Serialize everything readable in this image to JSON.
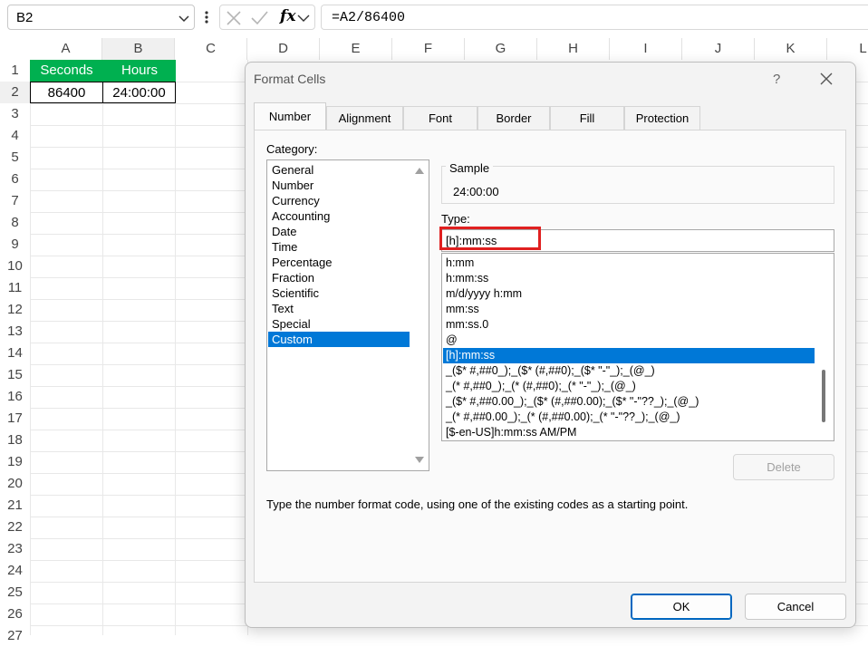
{
  "formula_bar": {
    "name_box": "B2",
    "formula": "=A2/86400",
    "fx_label": "fx"
  },
  "sheet": {
    "columns": [
      "A",
      "B",
      "C",
      "D",
      "E",
      "F",
      "G",
      "H",
      "I",
      "J",
      "K",
      "L"
    ],
    "rows": [
      "1",
      "2",
      "3",
      "4",
      "5",
      "6",
      "7",
      "8",
      "9",
      "10",
      "11",
      "12",
      "13",
      "14",
      "15",
      "16",
      "17",
      "18",
      "19",
      "20",
      "21",
      "22",
      "23",
      "24",
      "25",
      "26",
      "27"
    ],
    "cells": {
      "a1": "Seconds",
      "b1": "Hours",
      "a2": "86400",
      "b2": "24:00:00"
    },
    "header_fill": "#00b050"
  },
  "dialog": {
    "title": "Format Cells",
    "help": "?",
    "tabs": [
      "Number",
      "Alignment",
      "Font",
      "Border",
      "Fill",
      "Protection"
    ],
    "active_tab": "Number",
    "category_label": "Category:",
    "categories": [
      "General",
      "Number",
      "Currency",
      "Accounting",
      "Date",
      "Time",
      "Percentage",
      "Fraction",
      "Scientific",
      "Text",
      "Special",
      "Custom"
    ],
    "selected_category": "Custom",
    "sample_label": "Sample",
    "sample_value": "24:00:00",
    "type_label": "Type:",
    "type_value": "[h]:mm:ss",
    "type_list": [
      "h:mm",
      "h:mm:ss",
      "m/d/yyyy h:mm",
      "mm:ss",
      "mm:ss.0",
      "@",
      "[h]:mm:ss",
      "_($* #,##0_);_($* (#,##0);_($* \"-\"_);_(@_)",
      "_(* #,##0_);_(* (#,##0);_(* \"-\"_);_(@_)",
      "_($* #,##0.00_);_($* (#,##0.00);_($* \"-\"??_);_(@_)",
      "_(* #,##0.00_);_(* (#,##0.00);_(* \"-\"??_);_(@_)",
      "[$-en-US]h:mm:ss AM/PM"
    ],
    "selected_type": "[h]:mm:ss",
    "delete_button": "Delete",
    "description": "Type the number format code, using one of the existing codes as a starting point.",
    "ok_button": "OK",
    "cancel_button": "Cancel",
    "accent_color": "#0078d7",
    "highlight_color": "#e02020"
  }
}
